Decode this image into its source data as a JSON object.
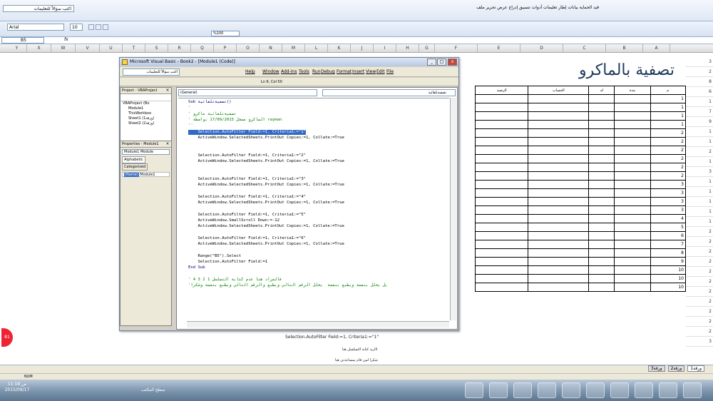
{
  "excel": {
    "ask_placeholder": "اكتب سؤالاً للتعليمات",
    "ribbon_menu_text": "قيد الحماية  بيانات  إطار  تعليمات  أدوات  تنسيق  إدراج  عرض  تحرير  ملف",
    "font_name": "Arial",
    "font_size": "10",
    "zoom": "%100",
    "name_box": "B5",
    "fx": "fx",
    "columns": [
      "Y",
      "X",
      "W",
      "V",
      "U",
      "T",
      "S",
      "R",
      "Q",
      "P",
      "O",
      "N",
      "M",
      "L",
      "K",
      "J",
      "I",
      "H",
      "G",
      "F",
      "E",
      "D",
      "C",
      "B",
      "A"
    ],
    "status": "NUM",
    "sheet_tabs": [
      "ورقة1",
      "ورقة2",
      "ورقة3"
    ]
  },
  "sheet": {
    "title": "تصفية بالماكرو",
    "headers": [
      "م",
      "مدة",
      "له",
      "الحساب",
      "الرصيد"
    ],
    "row_values": [
      "1",
      "1",
      "1",
      "1",
      "2",
      "2",
      "2",
      "2",
      "2",
      "2",
      "3",
      "3",
      "3",
      "3",
      "4",
      "5",
      "6",
      "7",
      "8",
      "9",
      "10",
      "10",
      "10"
    ],
    "right_col": [
      "3",
      "2",
      "8",
      "6",
      "1",
      "7",
      "9",
      "1",
      "1",
      "2",
      "1",
      "3",
      "1",
      "1",
      "1",
      "1",
      "1",
      "2",
      "2",
      "2",
      "2",
      "2",
      "2",
      "2",
      "2",
      "2",
      "2",
      "2",
      "3"
    ]
  },
  "vba": {
    "title": "Microsoft Visual Basic - Book2 - [Module1 (Code)]",
    "ask_placeholder": "اكتب سؤالاً للتعليمات",
    "menu": [
      "Help",
      "Window",
      "Add-Ins",
      "Tools",
      "Run",
      "Debug",
      "Format",
      "Insert",
      "View",
      "Edit",
      "File"
    ],
    "cursor_pos": "Ln 6, Col 50",
    "project_title": "Project - VBAProject",
    "tree": [
      "VBAProject (Bo",
      "Module1",
      "ThisWorkboo",
      "Sheet1 (ورقة1)",
      "Sheet2 (ورقة2)"
    ],
    "props_title": "Properties - Module1",
    "props_object": "Module1 Module",
    "tab_alpha": "Alphabetic",
    "tab_cat": "Categorized",
    "prop_name": "(Name)",
    "prop_val": "Module1",
    "combo_general": "(General)",
    "combo_proc": "تصفيةتلقائية",
    "code_lines": [
      {
        "t": "Sub تصفيةتلقائية()",
        "c": "kw"
      },
      {
        "t": "'",
        "c": "cm"
      },
      {
        "t": "' تصفيةتلقائية ماكرو",
        "c": "cm"
      },
      {
        "t": "' الماكرو مسجل 17/09/2015 بواسطة rayman",
        "c": "cm"
      },
      {
        "t": "''",
        "c": "cm"
      },
      {
        "t": "    Selection.AutoFilter Field:=1, Criteria1:=\"1\"",
        "c": "hl"
      },
      {
        "t": "    ActiveWindow.SelectedSheets.PrintOut Copies:=1, Collate:=True",
        "c": ""
      },
      {
        "t": "",
        "c": ""
      },
      {
        "t": "",
        "c": ""
      },
      {
        "t": "    Selection.AutoFilter Field:=1, Criteria1:=\"2\"",
        "c": ""
      },
      {
        "t": "    ActiveWindow.SelectedSheets.PrintOut Copies:=1, Collate:=True",
        "c": ""
      },
      {
        "t": "",
        "c": ""
      },
      {
        "t": "",
        "c": ""
      },
      {
        "t": "    Selection.AutoFilter Field:=1, Criteria1:=\"3\"",
        "c": ""
      },
      {
        "t": "    ActiveWindow.SelectedSheets.PrintOut Copies:=1, Collate:=True",
        "c": ""
      },
      {
        "t": "",
        "c": ""
      },
      {
        "t": "    Selection.AutoFilter Field:=1, Criteria1:=\"4\"",
        "c": ""
      },
      {
        "t": "    ActiveWindow.SelectedSheets.PrintOut Copies:=1, Collate:=True",
        "c": ""
      },
      {
        "t": "",
        "c": ""
      },
      {
        "t": "    Selection.AutoFilter Field:=1, Criteria1:=\"5\"",
        "c": ""
      },
      {
        "t": "    ActiveWindow.SmallScroll Down:=-12",
        "c": ""
      },
      {
        "t": "    ActiveWindow.SelectedSheets.PrintOut Copies:=1, Collate:=True",
        "c": ""
      },
      {
        "t": "",
        "c": ""
      },
      {
        "t": "    Selection.AutoFilter Field:=1, Criteria1:=\"6\"",
        "c": ""
      },
      {
        "t": "    ActiveWindow.SelectedSheets.PrintOut Copies:=1, Collate:=True",
        "c": ""
      },
      {
        "t": "",
        "c": ""
      },
      {
        "t": "    Range(\"B5\").Select",
        "c": ""
      },
      {
        "t": "    Selection.AutoFilter Field:=1",
        "c": ""
      },
      {
        "t": "End Sub",
        "c": "kw"
      },
      {
        "t": "",
        "c": ""
      },
      {
        "t": "' فالمراد هنا عدم كتابة التسلسل 1 2 3 4",
        "c": "cm"
      },
      {
        "t": "'بل يحلل بنفسة ويطبع بنفسة  يحلل الرقم التالي ويطبع والرقم التالي ويطبع بنفسة وشكرا",
        "c": "cm"
      }
    ]
  },
  "cells": {
    "line1": "Selection.AutoFilter Field:=1, Criteria1:=\"1\"",
    "line2": "لااريد كتابة التسلسل هنا",
    "line3": "شكرا لمن قام بمساعدتي هنا"
  },
  "taskbar": {
    "time": "11:18 ص",
    "date": "2015/09/17",
    "desktop": "سطح المكتب"
  }
}
